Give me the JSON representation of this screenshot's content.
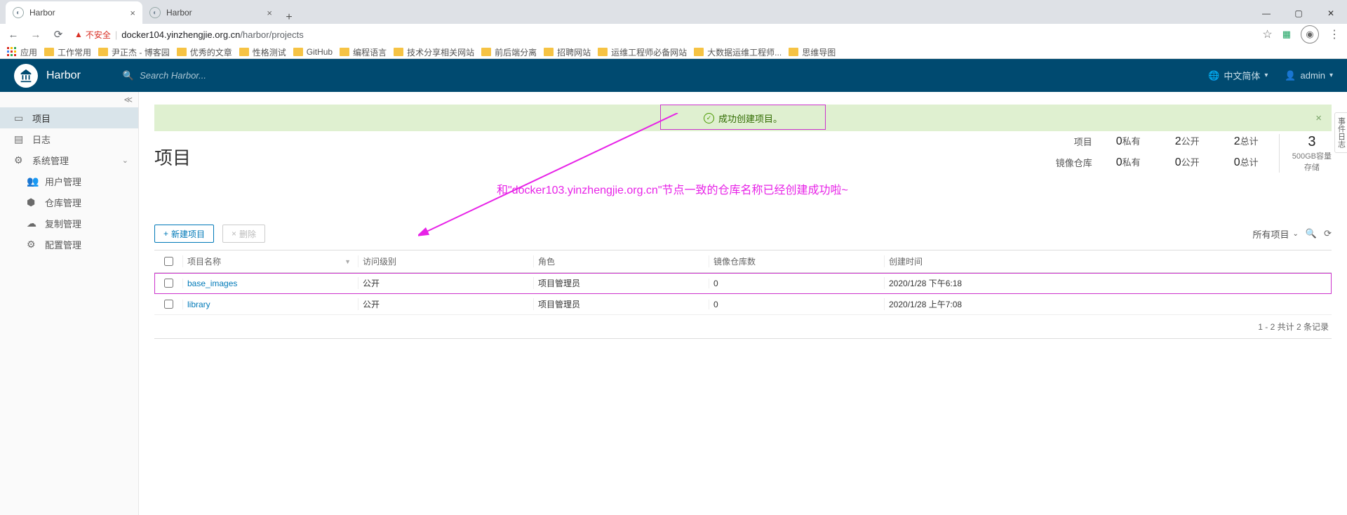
{
  "browser": {
    "tabs": [
      {
        "title": "Harbor",
        "active": true
      },
      {
        "title": "Harbor",
        "active": false
      }
    ],
    "insecure_label": "不安全",
    "url_host": "docker104.yinzhengjie.org.cn",
    "url_path": "/harbor/projects"
  },
  "bookmarks": {
    "apps": "应用",
    "items": [
      "工作常用",
      "尹正杰 - 博客园",
      "优秀的文章",
      "性格测试",
      "GitHub",
      "编程语言",
      "技术分享相关网站",
      "前后端分离",
      "招聘网站",
      "运维工程师必备网站",
      "大数据运维工程师...",
      "思维导图"
    ]
  },
  "header": {
    "brand": "Harbor",
    "search_placeholder": "Search Harbor...",
    "lang": "中文简体",
    "user": "admin"
  },
  "sidebar": {
    "items": [
      {
        "label": "项目",
        "icon": "project"
      },
      {
        "label": "日志",
        "icon": "log"
      },
      {
        "label": "系统管理",
        "icon": "admin",
        "expandable": true
      },
      {
        "label": "用户管理",
        "icon": "user",
        "sub": true
      },
      {
        "label": "仓库管理",
        "icon": "repo",
        "sub": true
      },
      {
        "label": "复制管理",
        "icon": "replicate",
        "sub": true
      },
      {
        "label": "配置管理",
        "icon": "config",
        "sub": true
      }
    ]
  },
  "banner": {
    "text": "成功创建项目。"
  },
  "page": {
    "title": "项目"
  },
  "stats": {
    "row1_label": "项目",
    "row2_label": "镜像仓库",
    "private": {
      "count": "0",
      "label": "私有"
    },
    "public": {
      "count": "2",
      "label": "公开"
    },
    "total": {
      "count": "2",
      "label": "总计"
    },
    "repo_private": {
      "count": "0",
      "label": "私有"
    },
    "repo_public": {
      "count": "0",
      "label": "公开"
    },
    "repo_total": {
      "count": "0",
      "label": "总计"
    },
    "storage": {
      "big": "3",
      "line1": "500GB容量",
      "line2": "存储"
    }
  },
  "annotation": "和\"docker103.yinzhengjie.org.cn\"节点一致的仓库名称已经创建成功啦~",
  "actions": {
    "new": "新建项目",
    "delete": "删除",
    "filter": "所有项目"
  },
  "table": {
    "headers": {
      "name": "项目名称",
      "access": "访问级别",
      "role": "角色",
      "repo": "镜像仓库数",
      "time": "创建时间"
    },
    "rows": [
      {
        "name": "base_images",
        "access": "公开",
        "role": "项目管理员",
        "repo": "0",
        "time": "2020/1/28 下午6:18",
        "hi": true
      },
      {
        "name": "library",
        "access": "公开",
        "role": "项目管理员",
        "repo": "0",
        "time": "2020/1/28 上午7:08",
        "hi": false
      }
    ],
    "footer": "1 - 2 共计 2 条记录"
  },
  "side_tab": "事件日志"
}
